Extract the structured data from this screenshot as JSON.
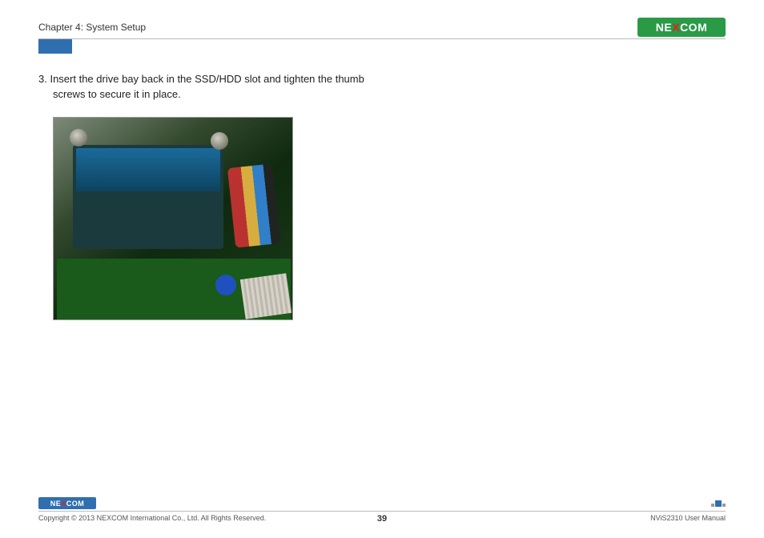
{
  "header": {
    "chapter": "Chapter 4: System Setup",
    "logo_text_pre": "NE",
    "logo_text_x": "X",
    "logo_text_post": "COM"
  },
  "content": {
    "step_number": "3.",
    "step_text_line1": "Insert the drive bay back in the SSD/HDD slot and tighten the thumb",
    "step_text_line2": "screws to secure it in place.",
    "image_alt": "Photograph of computer chassis interior showing a blue-labeled 2.5-inch drive mounted in a bay with thumb screws, colored cables, and a green PCB."
  },
  "footer": {
    "logo_text_pre": "NE",
    "logo_text_x": "X",
    "logo_text_post": "COM",
    "copyright": "Copyright © 2013 NEXCOM International Co., Ltd. All Rights Reserved.",
    "page_number": "39",
    "manual": "NViS2310 User Manual"
  }
}
